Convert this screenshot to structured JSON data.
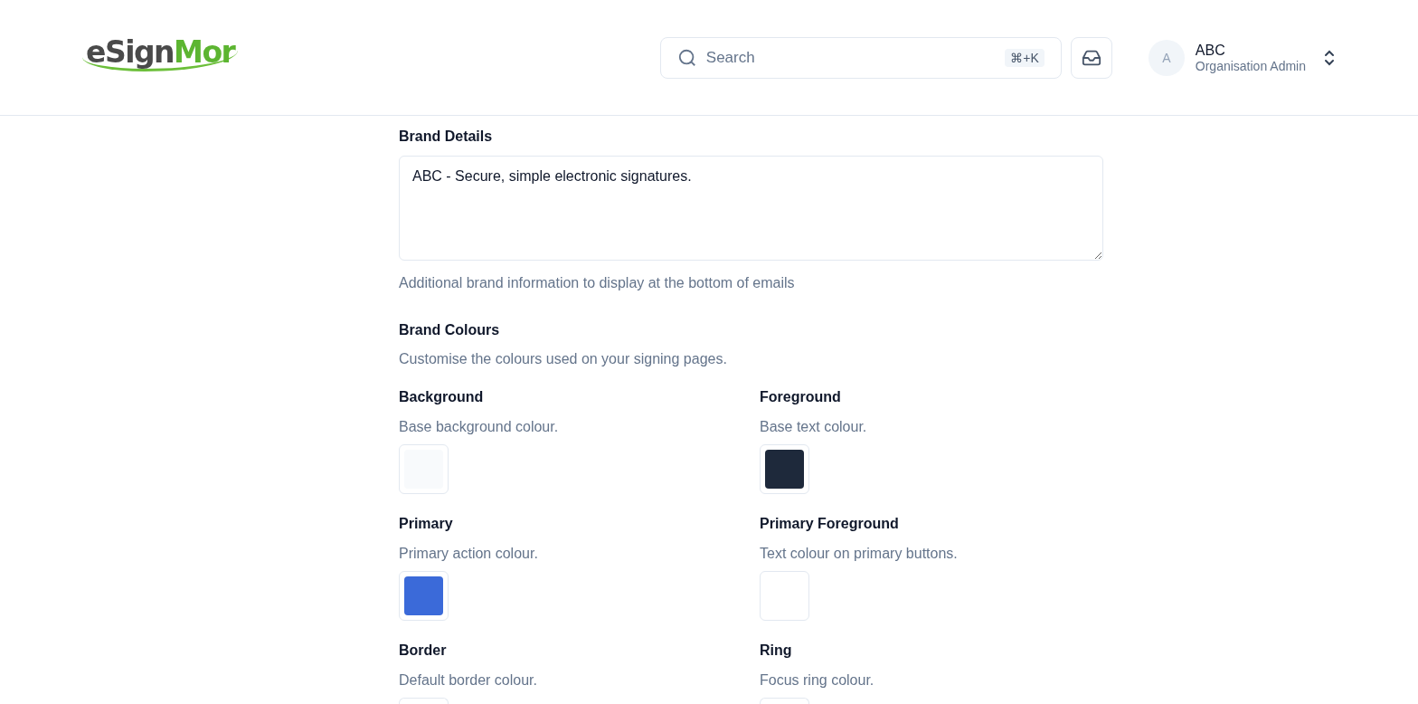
{
  "header": {
    "logo": {
      "dark": "eSign",
      "green": "Mor"
    },
    "search": {
      "placeholder": "Search",
      "shortcut": "⌘+K"
    },
    "user": {
      "avatar": "A",
      "name": "ABC",
      "role": "Organisation Admin"
    }
  },
  "brand_details": {
    "label": "Brand Details",
    "value": "ABC - Secure, simple electronic signatures.",
    "help": "Additional brand information to display at the bottom of emails"
  },
  "brand_colours": {
    "title": "Brand Colours",
    "description": "Customise the colours used on your signing pages.",
    "items": [
      {
        "label": "Background",
        "description": "Base background colour.",
        "color": "#f8fafc"
      },
      {
        "label": "Foreground",
        "description": "Base text colour.",
        "color": "#1e293b"
      },
      {
        "label": "Primary",
        "description": "Primary action colour.",
        "color": "#3b6ad9"
      },
      {
        "label": "Primary Foreground",
        "description": "Text colour on primary buttons.",
        "color": "#ffffff"
      },
      {
        "label": "Border",
        "description": "Default border colour."
      },
      {
        "label": "Ring",
        "description": "Focus ring colour."
      }
    ]
  }
}
